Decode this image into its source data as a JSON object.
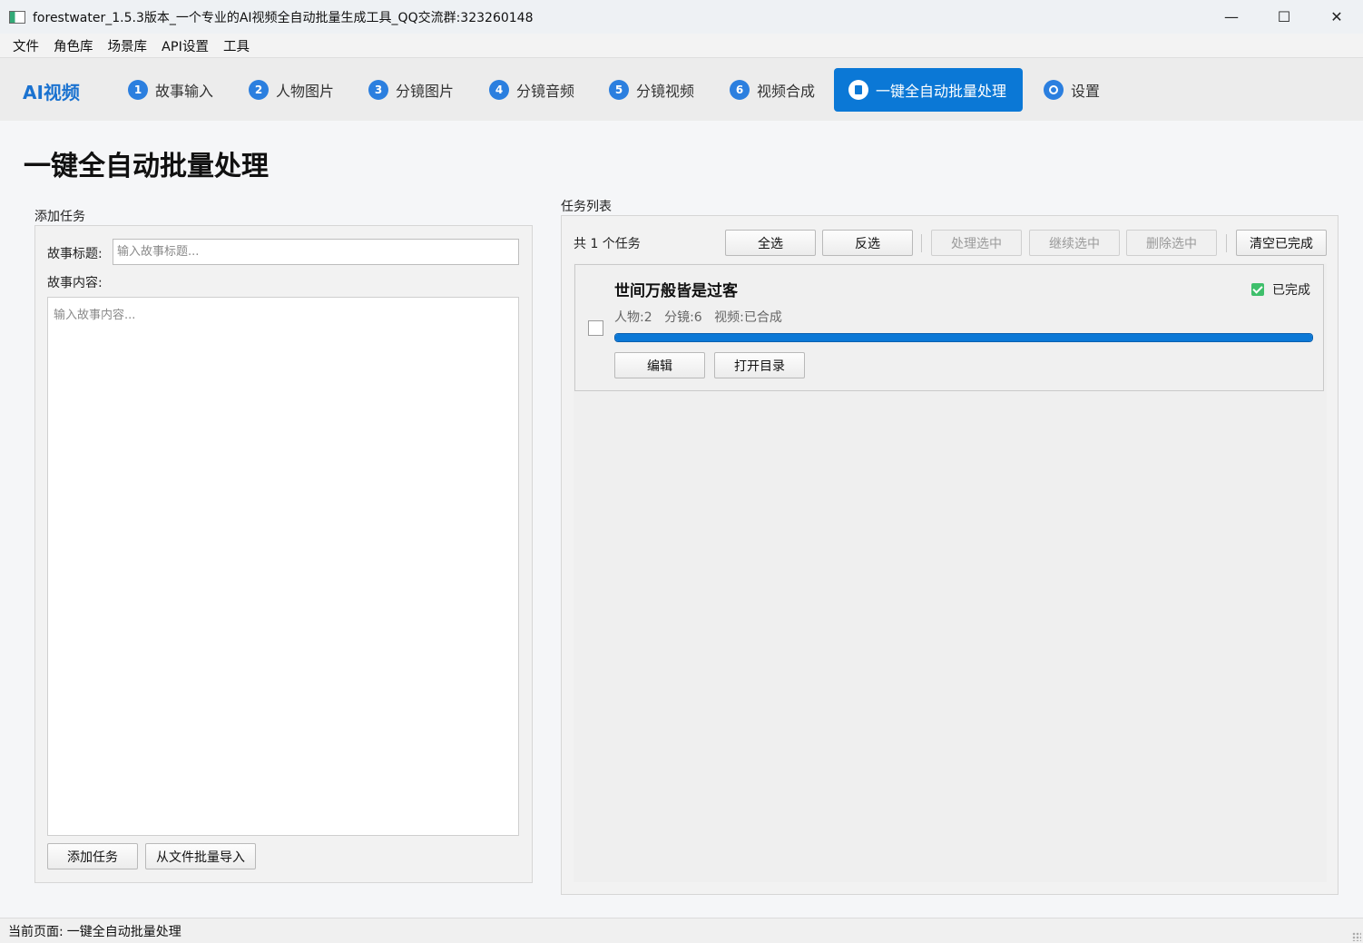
{
  "window": {
    "title": "forestwater_1.5.3版本_一个专业的AI视频全自动批量生成工具_QQ交流群:323260148",
    "minimize": "—",
    "maximize": "☐",
    "close": "✕"
  },
  "menu": [
    "文件",
    "角色库",
    "场景库",
    "API设置",
    "工具"
  ],
  "nav": {
    "brand": "AI视频",
    "tabs": [
      {
        "num": "1",
        "label": "故事输入"
      },
      {
        "num": "2",
        "label": "人物图片"
      },
      {
        "num": "3",
        "label": "分镜图片"
      },
      {
        "num": "4",
        "label": "分镜音频"
      },
      {
        "num": "5",
        "label": "分镜视频"
      },
      {
        "num": "6",
        "label": "视频合成"
      },
      {
        "label": "一键全自动批量处理",
        "active": true
      },
      {
        "label": "设置"
      }
    ]
  },
  "page": {
    "title": "一键全自动批量处理"
  },
  "add_task": {
    "group_title": "添加任务",
    "title_label": "故事标题:",
    "title_placeholder": "输入故事标题...",
    "title_value": "",
    "content_label": "故事内容:",
    "content_placeholder": "输入故事内容...",
    "content_value": "",
    "add_button": "添加任务",
    "import_button": "从文件批量导入"
  },
  "task_list": {
    "group_title": "任务列表",
    "count_text": "共 1 个任务",
    "buttons": {
      "select_all": "全选",
      "invert": "反选",
      "process_selected": "处理选中",
      "continue_selected": "继续选中",
      "delete_selected": "删除选中",
      "clear_done": "清空已完成"
    },
    "tasks": [
      {
        "title": "世间万般皆是过客",
        "characters": "人物:2",
        "shots": "分镜:6",
        "video": "视频:已合成",
        "status": "已完成",
        "status_color": "#3fbf6b",
        "progress": 1.0,
        "edit_button": "编辑",
        "open_dir_button": "打开目录"
      }
    ]
  },
  "statusbar": {
    "label": "当前页面:",
    "value": "一键全自动批量处理"
  },
  "colors": {
    "accent": "#0b78d6",
    "brand": "#1a72d0"
  }
}
